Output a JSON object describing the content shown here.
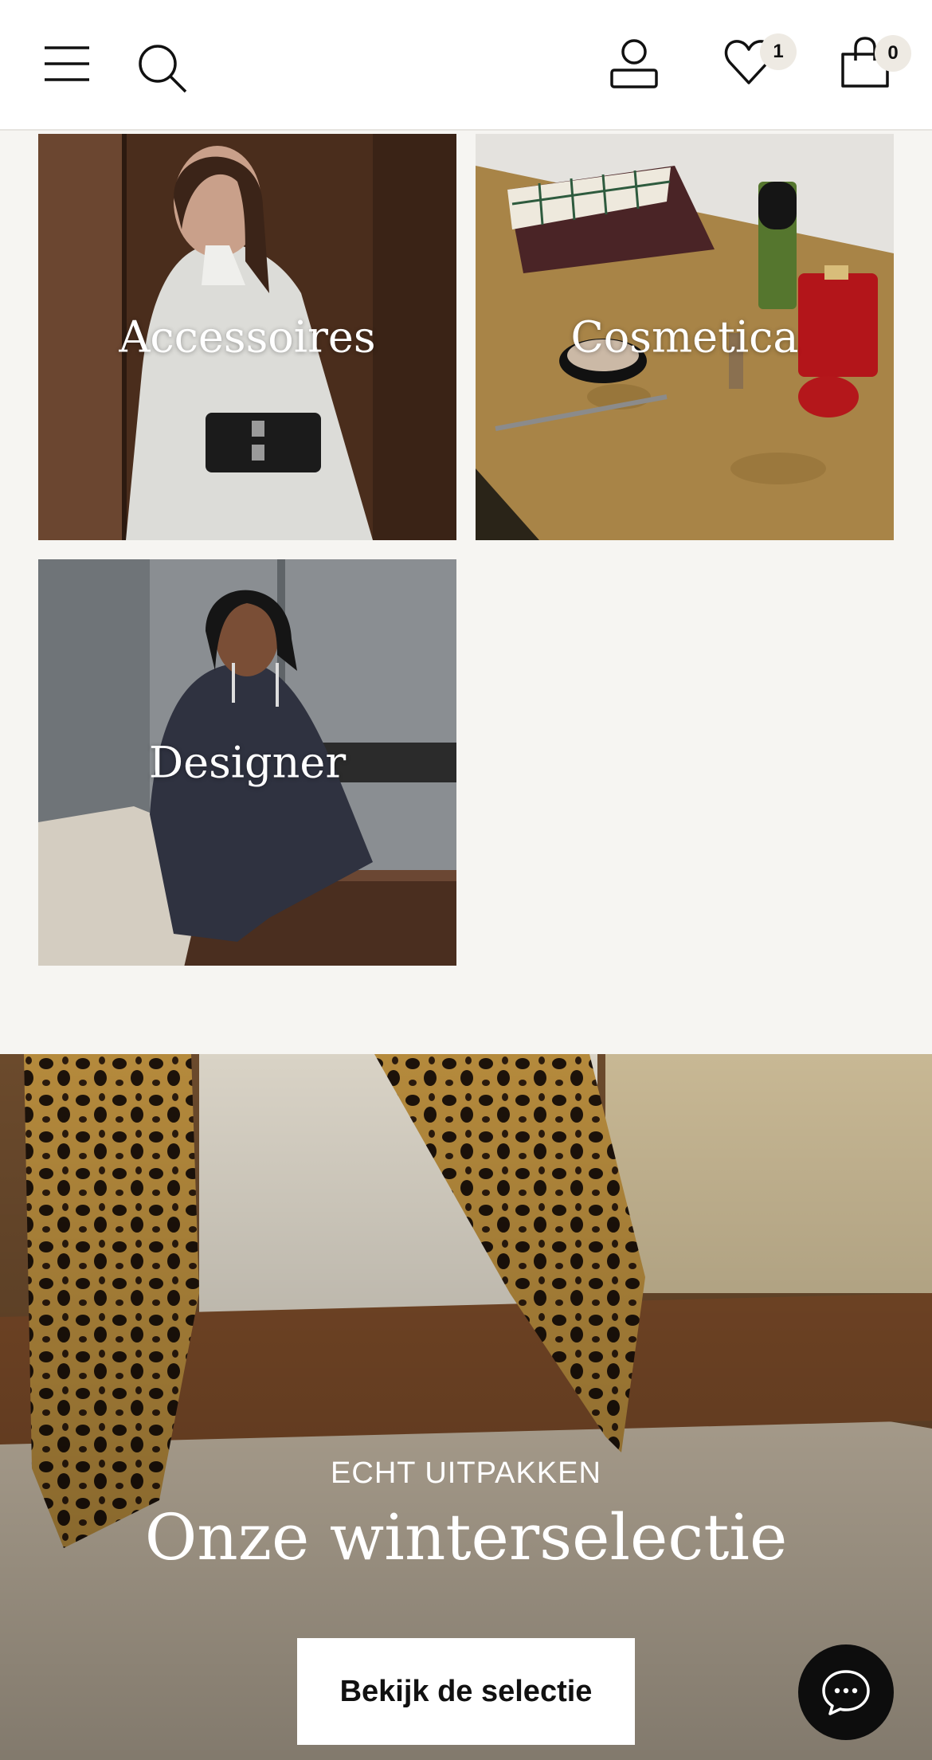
{
  "header": {
    "wishlist_count": "1",
    "cart_count": "0",
    "icons": [
      "menu-icon",
      "search-icon",
      "account-icon",
      "heart-icon",
      "bag-icon"
    ]
  },
  "categories": [
    {
      "label": "Accessoires"
    },
    {
      "label": "Cosmetica"
    },
    {
      "label": "Designer"
    }
  ],
  "promo": {
    "eyebrow": "ECHT UITPAKKEN",
    "title": "Onze winterselectie",
    "button_label": "Bekijk de selectie"
  },
  "chat": {
    "icon": "chat-icon"
  },
  "colors": {
    "page_background": "#f6f5f2",
    "header_background": "#ffffff",
    "badge_background": "#eeeae3",
    "chat_button": "#0d0d0d"
  }
}
